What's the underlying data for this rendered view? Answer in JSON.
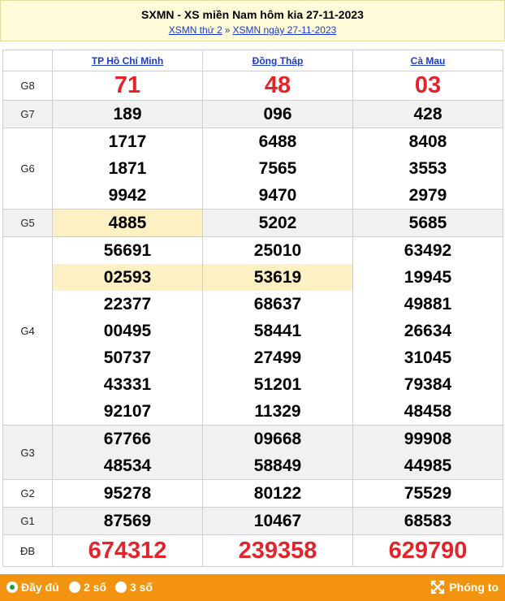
{
  "header": {
    "title": "SXMN - XS miền Nam hôm kia 27-11-2023",
    "crumb1": "XSMN thứ 2",
    "separator": "»",
    "crumb2": "XSMN ngày 27-11-2023"
  },
  "columns": [
    "TP Hồ Chí Minh",
    "Đồng Tháp",
    "Cà Mau"
  ],
  "prizes": [
    {
      "label": "G8",
      "values": [
        [
          "71"
        ],
        [
          "48"
        ],
        [
          "03"
        ]
      ]
    },
    {
      "label": "G7",
      "values": [
        [
          "189"
        ],
        [
          "096"
        ],
        [
          "428"
        ]
      ]
    },
    {
      "label": "G6",
      "values": [
        [
          "1717",
          "1871",
          "9942"
        ],
        [
          "6488",
          "7565",
          "9470"
        ],
        [
          "8408",
          "3553",
          "2979"
        ]
      ]
    },
    {
      "label": "G5",
      "values": [
        [
          "4885"
        ],
        [
          "5202"
        ],
        [
          "5685"
        ]
      ]
    },
    {
      "label": "G4",
      "values": [
        [
          "56691",
          "02593",
          "22377",
          "00495",
          "50737",
          "43331",
          "92107"
        ],
        [
          "25010",
          "53619",
          "68637",
          "58441",
          "27499",
          "51201",
          "11329"
        ],
        [
          "63492",
          "19945",
          "49881",
          "26634",
          "31045",
          "79384",
          "48458"
        ]
      ]
    },
    {
      "label": "G3",
      "values": [
        [
          "67766",
          "48534"
        ],
        [
          "09668",
          "58849"
        ],
        [
          "99908",
          "44985"
        ]
      ]
    },
    {
      "label": "G2",
      "values": [
        [
          "95278"
        ],
        [
          "80122"
        ],
        [
          "75529"
        ]
      ]
    },
    {
      "label": "G1",
      "values": [
        [
          "87569"
        ],
        [
          "10467"
        ],
        [
          "68583"
        ]
      ]
    },
    {
      "label": "ĐB",
      "values": [
        [
          "674312"
        ],
        [
          "239358"
        ],
        [
          "629790"
        ]
      ]
    }
  ],
  "footer": {
    "opt_full": "Đầy đủ",
    "opt_2": "2 số",
    "opt_3": "3 số",
    "zoom": "Phóng to"
  },
  "colors": {
    "accent_red": "#e4242b",
    "link_blue": "#1a3cc8",
    "footer_orange": "#f2940f",
    "highlight": "#fdf0c2"
  }
}
